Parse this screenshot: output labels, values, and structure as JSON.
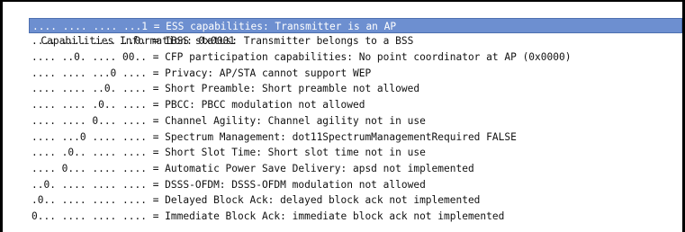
{
  "header": {
    "toggle_icon": "▽",
    "text": "Capabilities Information: 0x0001"
  },
  "fields": [
    {
      "text": ".... .... .... ...1 = ESS capabilities: Transmitter is an AP",
      "selected": true
    },
    {
      "text": ".... .... .... ..0. = IBSS status: Transmitter belongs to a BSS",
      "selected": false
    },
    {
      "text": ".... ..0. .... 00.. = CFP participation capabilities: No point coordinator at AP (0x0000)",
      "selected": false
    },
    {
      "text": ".... .... ...0 .... = Privacy: AP/STA cannot support WEP",
      "selected": false
    },
    {
      "text": ".... .... ..0. .... = Short Preamble: Short preamble not allowed",
      "selected": false
    },
    {
      "text": ".... .... .0.. .... = PBCC: PBCC modulation not allowed",
      "selected": false
    },
    {
      "text": ".... .... 0... .... = Channel Agility: Channel agility not in use",
      "selected": false
    },
    {
      "text": ".... ...0 .... .... = Spectrum Management: dot11SpectrumManagementRequired FALSE",
      "selected": false
    },
    {
      "text": ".... .0.. .... .... = Short Slot Time: Short slot time not in use",
      "selected": false
    },
    {
      "text": ".... 0... .... .... = Automatic Power Save Delivery: apsd not implemented",
      "selected": false
    },
    {
      "text": "..0. .... .... .... = DSSS-OFDM: DSSS-OFDM modulation not allowed",
      "selected": false
    },
    {
      "text": ".0.. .... .... .... = Delayed Block Ack: delayed block ack not implemented",
      "selected": false
    },
    {
      "text": "0... .... .... .... = Immediate Block Ack: immediate block ack not implemented",
      "selected": false
    }
  ]
}
